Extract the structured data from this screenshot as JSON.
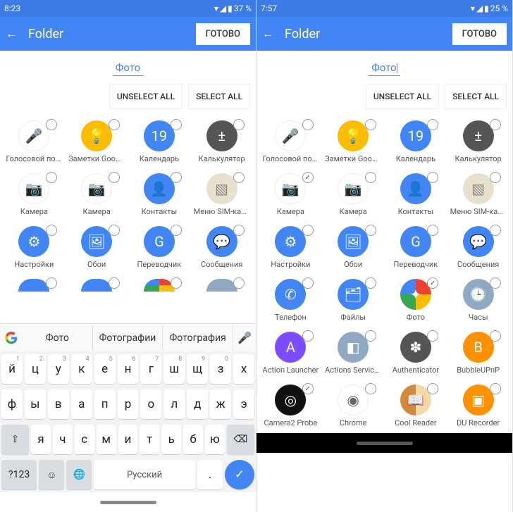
{
  "left": {
    "status": {
      "time": "8:23",
      "battery": "37 %"
    },
    "appbar": {
      "title": "Folder",
      "done": "ГОТОВО"
    },
    "folder_name": "Фото",
    "actions": {
      "unselect": "UNSELECT ALL",
      "select": "SELECT ALL"
    },
    "apps": [
      [
        {
          "label": "Голосовой пои..",
          "cls": "ic-white",
          "g": "🎤"
        },
        {
          "label": "Заметки Googl..",
          "cls": "ic-yellow",
          "g": "💡"
        },
        {
          "label": "Календарь",
          "cls": "ic-blue",
          "g": "19"
        },
        {
          "label": "Калькулятор",
          "cls": "ic-dark",
          "g": "±"
        }
      ],
      [
        {
          "label": "Камера",
          "cls": "ic-white",
          "g": "📷"
        },
        {
          "label": "Камера",
          "cls": "ic-white",
          "g": "📷"
        },
        {
          "label": "Контакты",
          "cls": "ic-blue",
          "g": "👤"
        },
        {
          "label": "Меню SIM-карт..",
          "cls": "ic-tan",
          "g": "▧"
        }
      ],
      [
        {
          "label": "Настройки",
          "cls": "ic-blue",
          "g": "⚙"
        },
        {
          "label": "Обои",
          "cls": "ic-blue",
          "g": "🖼"
        },
        {
          "label": "Переводчик",
          "cls": "ic-blue",
          "g": "G"
        },
        {
          "label": "Сообщения",
          "cls": "ic-blue",
          "g": "💬"
        }
      ]
    ],
    "suggestions": [
      "Фото",
      "Фотографии",
      "Фотография"
    ],
    "keys_r1": [
      {
        "c": "й",
        "n": "1"
      },
      {
        "c": "ц",
        "n": "2"
      },
      {
        "c": "у",
        "n": "3"
      },
      {
        "c": "к",
        "n": "4"
      },
      {
        "c": "е",
        "n": "5"
      },
      {
        "c": "н",
        "n": "6"
      },
      {
        "c": "г",
        "n": "7"
      },
      {
        "c": "ш",
        "n": "8"
      },
      {
        "c": "щ",
        "n": "9"
      },
      {
        "c": "з",
        "n": "0"
      },
      {
        "c": "х",
        "n": ""
      }
    ],
    "keys_r2": [
      "ф",
      "ы",
      "в",
      "а",
      "п",
      "р",
      "о",
      "л",
      "д",
      "ж",
      "э"
    ],
    "keys_r3": [
      "я",
      "ч",
      "с",
      "м",
      "и",
      "т",
      "ь",
      "б",
      "ю"
    ],
    "keys_bottom": {
      "sym": "?123",
      "lang": "Русский"
    }
  },
  "right": {
    "status": {
      "time": "7:57",
      "battery": "25 %"
    },
    "appbar": {
      "title": "Folder",
      "done": "ГОТОВО"
    },
    "folder_name": "Фото",
    "actions": {
      "unselect": "UNSELECT ALL",
      "select": "SELECT ALL"
    },
    "apps": [
      [
        {
          "label": "Голосовой пои..",
          "cls": "ic-white",
          "g": "🎤",
          "chk": false
        },
        {
          "label": "Заметки Googl..",
          "cls": "ic-yellow",
          "g": "💡",
          "chk": false
        },
        {
          "label": "Календарь",
          "cls": "ic-blue",
          "g": "19",
          "chk": false
        },
        {
          "label": "Калькулятор",
          "cls": "ic-dark",
          "g": "±",
          "chk": false
        }
      ],
      [
        {
          "label": "Камера",
          "cls": "ic-white",
          "g": "📷",
          "chk": true
        },
        {
          "label": "Камера",
          "cls": "ic-white",
          "g": "📷",
          "chk": false
        },
        {
          "label": "Контакты",
          "cls": "ic-blue",
          "g": "👤",
          "chk": false
        },
        {
          "label": "Меню SIM-карт..",
          "cls": "ic-tan",
          "g": "▧",
          "chk": false
        }
      ],
      [
        {
          "label": "Настройки",
          "cls": "ic-blue",
          "g": "⚙",
          "chk": false
        },
        {
          "label": "Обои",
          "cls": "ic-blue",
          "g": "🖼",
          "chk": false
        },
        {
          "label": "Переводчик",
          "cls": "ic-blue",
          "g": "G",
          "chk": false
        },
        {
          "label": "Сообщения",
          "cls": "ic-blue",
          "g": "💬",
          "chk": false
        }
      ],
      [
        {
          "label": "Телефон",
          "cls": "ic-blue",
          "g": "✆",
          "chk": false
        },
        {
          "label": "Файлы",
          "cls": "ic-blue",
          "g": "🗂",
          "chk": false
        },
        {
          "label": "Фото",
          "cls": "ic-multi",
          "g": "✦",
          "chk": true
        },
        {
          "label": "Часы",
          "cls": "ic-bluegray",
          "g": "🕒",
          "chk": false
        }
      ],
      [
        {
          "label": "Action Launcher",
          "cls": "ic-purple",
          "g": "A",
          "chk": false
        },
        {
          "label": "Actions Services",
          "cls": "ic-bluegray",
          "g": "◧",
          "chk": false
        },
        {
          "label": "Authenticator",
          "cls": "ic-dark",
          "g": "✽",
          "chk": false
        },
        {
          "label": "BubbleUPnP",
          "cls": "ic-orange",
          "g": "B",
          "chk": false
        }
      ],
      [
        {
          "label": "Camera2 Probe",
          "cls": "ic-black",
          "g": "◎",
          "chk": true
        },
        {
          "label": "Chrome",
          "cls": "ic-white",
          "g": "◉",
          "chk": false
        },
        {
          "label": "Cool Reader",
          "cls": "ic-book",
          "g": "📖",
          "chk": false
        },
        {
          "label": "DU Recorder",
          "cls": "ic-orange",
          "g": "▣",
          "chk": false
        }
      ]
    ]
  }
}
